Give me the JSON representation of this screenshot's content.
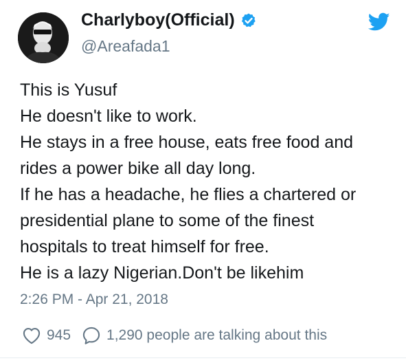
{
  "user": {
    "display_name": "Charlyboy(Official)",
    "handle": "@Areafada1",
    "verified": true,
    "avatar_icon": "profile-photo"
  },
  "tweet": {
    "lines": [
      "This is Yusuf",
      "He doesn't like to work.",
      "He stays in a free house, eats free food and",
      "rides a power bike all day long.",
      "If he has a headache, he flies a chartered or",
      "presidential plane to some of the finest",
      "hospitals to treat himself for free.",
      "He is a lazy Nigerian.Don't be likehim"
    ],
    "timestamp": "2:26 PM - Apr 21, 2018"
  },
  "actions": {
    "likes": "945",
    "replies_text": "1,290 people are talking about this",
    "like_icon": "heart-icon",
    "reply_icon": "speech-bubble-icon"
  },
  "brand": {
    "twitter_blue": "#1da1f2",
    "text_primary": "#14171a",
    "text_secondary": "#657786"
  }
}
